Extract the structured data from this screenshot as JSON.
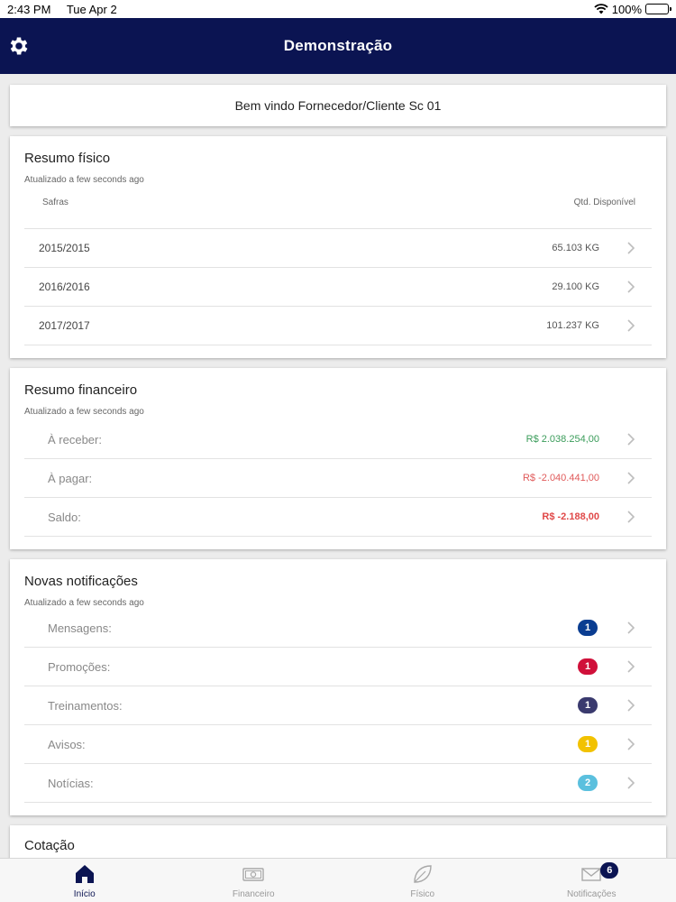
{
  "status_bar": {
    "time": "2:43 PM",
    "date": "Tue Apr 2",
    "battery": "100%"
  },
  "nav": {
    "title": "Demonstração",
    "settings_icon": "gear-icon"
  },
  "welcome": {
    "text": "Bem vindo Fornecedor/Cliente Sc 01"
  },
  "resumo_fisico": {
    "title": "Resumo físico",
    "updated": "Atualizado a few seconds ago",
    "col_safras": "Safras",
    "col_qtd": "Qtd. Disponível",
    "rows": [
      {
        "safra": "2015/2015",
        "qtd": "65.103 KG"
      },
      {
        "safra": "2016/2016",
        "qtd": "29.100 KG"
      },
      {
        "safra": "2017/2017",
        "qtd": "101.237 KG"
      }
    ]
  },
  "resumo_financeiro": {
    "title": "Resumo financeiro",
    "updated": "Atualizado a few seconds ago",
    "rows": [
      {
        "label": "À receber:",
        "value": "R$ 2.038.254,00"
      },
      {
        "label": "À pagar:",
        "value": "R$ -2.040.441,00"
      },
      {
        "label": "Saldo:",
        "value": "R$ -2.188,00"
      }
    ],
    "colors": {
      "positive": "#3a9c5a",
      "negative": "#e05a5a"
    }
  },
  "notificacoes": {
    "title": "Novas notificações",
    "updated": "Atualizado a few seconds ago",
    "rows": [
      {
        "label": "Mensagens:",
        "count": "1",
        "color": "#0a3d91"
      },
      {
        "label": "Promoções:",
        "count": "1",
        "color": "#d0103a"
      },
      {
        "label": "Treinamentos:",
        "count": "1",
        "color": "#3a3a6e"
      },
      {
        "label": "Avisos:",
        "count": "1",
        "color": "#f2c200"
      },
      {
        "label": "Notícias:",
        "count": "2",
        "color": "#5bc0de"
      }
    ]
  },
  "next_section": {
    "title": "Cotação"
  },
  "tab_bar": {
    "tabs": [
      {
        "label": "Início",
        "icon": "home-icon"
      },
      {
        "label": "Financeiro",
        "icon": "money-icon"
      },
      {
        "label": "Físico",
        "icon": "leaf-icon"
      },
      {
        "label": "Notificações",
        "icon": "mail-icon",
        "badge": "6"
      }
    ]
  }
}
